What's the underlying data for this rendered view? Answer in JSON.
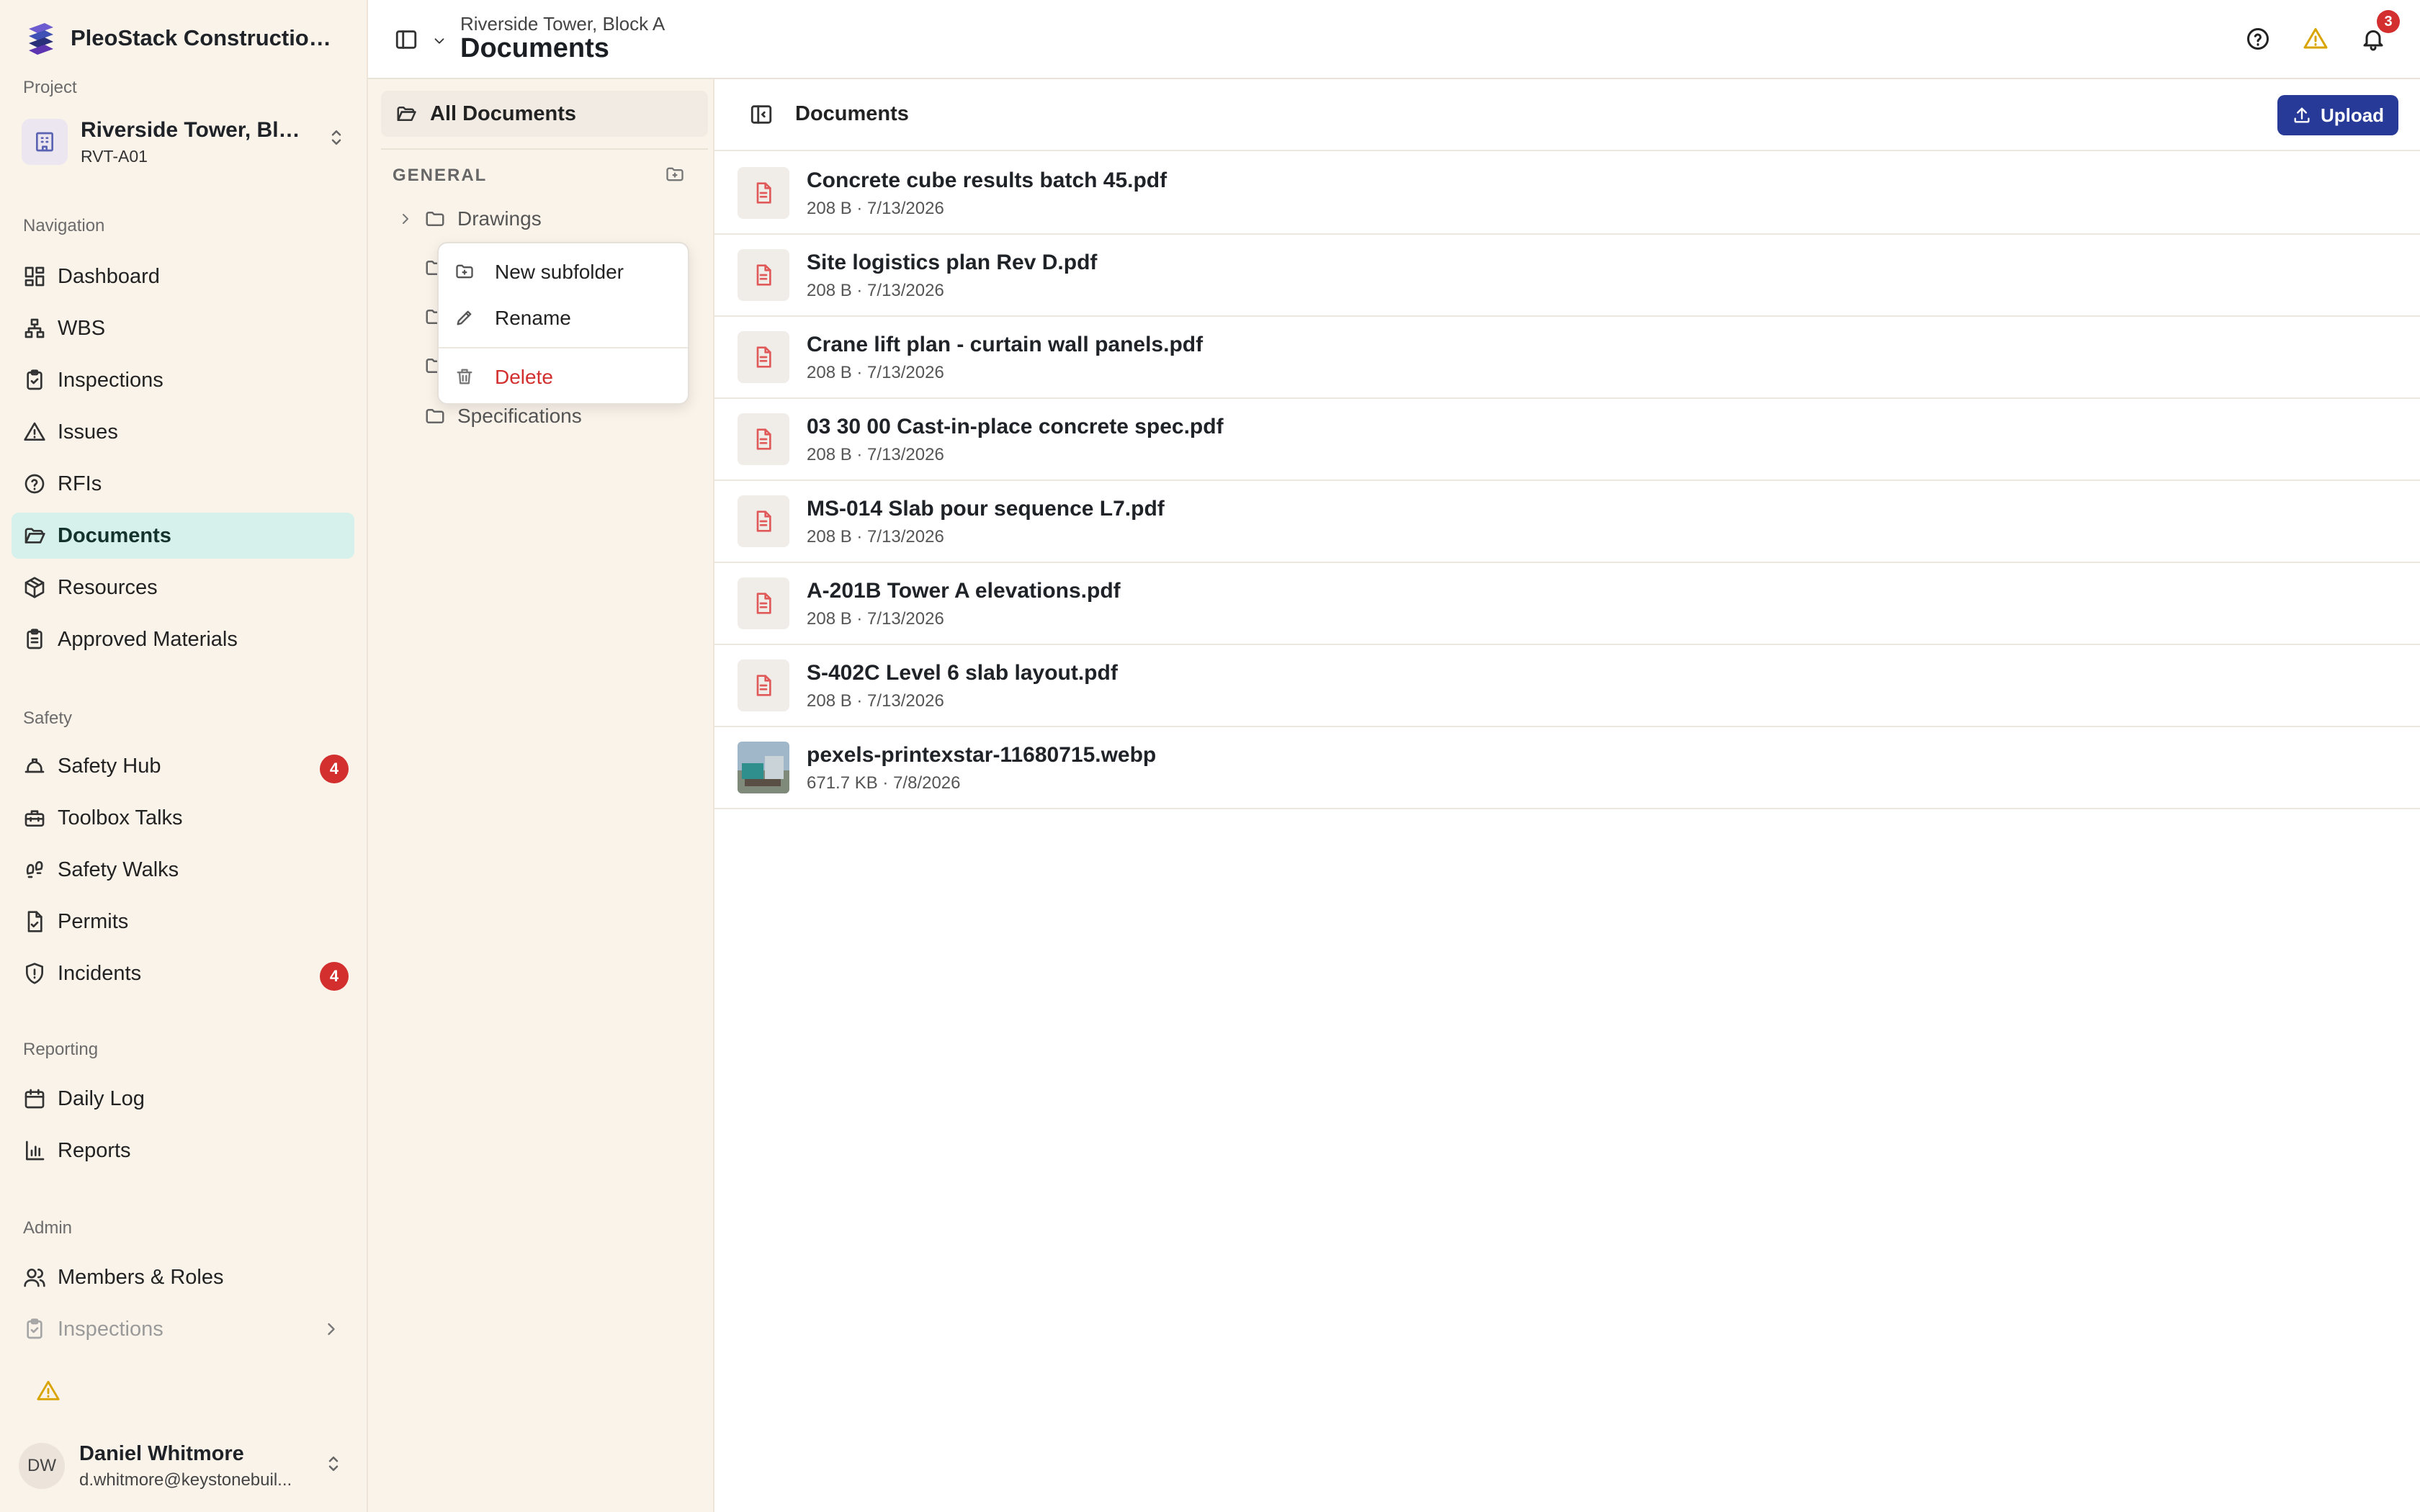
{
  "app": {
    "brand_name": "PleoStack Construction ..."
  },
  "project": {
    "section_label": "Project",
    "name": "Riverside Tower, Bloc...",
    "code": "RVT-A01"
  },
  "nav_sections": [
    {
      "label": "Navigation",
      "items": [
        {
          "label": "Dashboard",
          "icon": "dashboard-icon"
        },
        {
          "label": "WBS",
          "icon": "hierarchy-icon"
        },
        {
          "label": "Inspections",
          "icon": "clipboard-check-icon"
        },
        {
          "label": "Issues",
          "icon": "warning-icon"
        },
        {
          "label": "RFIs",
          "icon": "question-circle-icon"
        },
        {
          "label": "Documents",
          "icon": "folder-open-icon",
          "active": true
        },
        {
          "label": "Resources",
          "icon": "package-icon"
        },
        {
          "label": "Approved Materials",
          "icon": "clipboard-list-icon"
        }
      ]
    },
    {
      "label": "Safety",
      "items": [
        {
          "label": "Safety Hub",
          "icon": "hard-hat-icon",
          "badge": "4"
        },
        {
          "label": "Toolbox Talks",
          "icon": "toolbox-icon"
        },
        {
          "label": "Safety Walks",
          "icon": "footprints-icon"
        },
        {
          "label": "Permits",
          "icon": "file-check-icon"
        },
        {
          "label": "Incidents",
          "icon": "shield-alert-icon",
          "badge": "4"
        }
      ]
    },
    {
      "label": "Reporting",
      "items": [
        {
          "label": "Daily Log",
          "icon": "calendar-icon"
        },
        {
          "label": "Reports",
          "icon": "bar-chart-icon"
        }
      ]
    },
    {
      "label": "Admin",
      "items": [
        {
          "label": "Members & Roles",
          "icon": "users-icon"
        },
        {
          "label": "Inspections",
          "icon": "clipboard-check-icon",
          "faded": true
        }
      ]
    }
  ],
  "user": {
    "initials": "DW",
    "name": "Daniel Whitmore",
    "email": "d.whitmore@keystonebuil..."
  },
  "header": {
    "breadcrumb": "Riverside Tower, Block A",
    "title": "Documents",
    "notification_count": "3"
  },
  "folders": {
    "all_label": "All Documents",
    "section_label": "GENERAL",
    "tree": [
      {
        "label": "Drawings",
        "expandable": true
      },
      {
        "label": ""
      },
      {
        "label": ""
      },
      {
        "label": ""
      },
      {
        "label": "Specifications"
      }
    ]
  },
  "context_menu": {
    "items": [
      {
        "label": "New subfolder",
        "icon": "folder-plus-icon"
      },
      {
        "label": "Rename",
        "icon": "pencil-icon"
      },
      {
        "label": "Delete",
        "icon": "trash-icon",
        "danger": true
      }
    ]
  },
  "documents": {
    "title": "Documents",
    "upload_label": "Upload",
    "files": [
      {
        "name": "Concrete cube results batch 45.pdf",
        "size": "208 B",
        "date": "7/13/2026",
        "kind": "pdf"
      },
      {
        "name": "Site logistics plan Rev D.pdf",
        "size": "208 B",
        "date": "7/13/2026",
        "kind": "pdf"
      },
      {
        "name": "Crane lift plan - curtain wall panels.pdf",
        "size": "208 B",
        "date": "7/13/2026",
        "kind": "pdf"
      },
      {
        "name": "03 30 00 Cast-in-place concrete spec.pdf",
        "size": "208 B",
        "date": "7/13/2026",
        "kind": "pdf"
      },
      {
        "name": "MS-014 Slab pour sequence L7.pdf",
        "size": "208 B",
        "date": "7/13/2026",
        "kind": "pdf"
      },
      {
        "name": "A-201B Tower A elevations.pdf",
        "size": "208 B",
        "date": "7/13/2026",
        "kind": "pdf"
      },
      {
        "name": "S-402C Level 6 slab layout.pdf",
        "size": "208 B",
        "date": "7/13/2026",
        "kind": "pdf"
      },
      {
        "name": "pexels-printexstar-11680715.webp",
        "size": "671.7 KB",
        "date": "7/8/2026",
        "kind": "image"
      }
    ]
  },
  "colors": {
    "accent": "#283a97",
    "active_nav": "#d6f1ec",
    "sidebar_bg": "#faf3ea",
    "danger": "#d32f2f",
    "warning": "#d9a400"
  }
}
